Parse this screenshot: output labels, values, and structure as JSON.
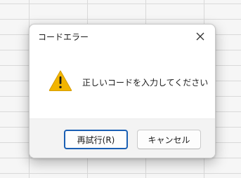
{
  "dialog": {
    "title": "コードエラー",
    "message": "正しいコードを入力してください",
    "buttons": {
      "retry_label": "再試行(R)",
      "cancel_label": "キャンセル"
    }
  },
  "icons": {
    "close": "close-icon",
    "warning": "warning-icon"
  },
  "colors": {
    "warning_fill": "#f2b500",
    "primary_border": "#1a5fb4",
    "footer_bg": "#f3f3f3"
  }
}
